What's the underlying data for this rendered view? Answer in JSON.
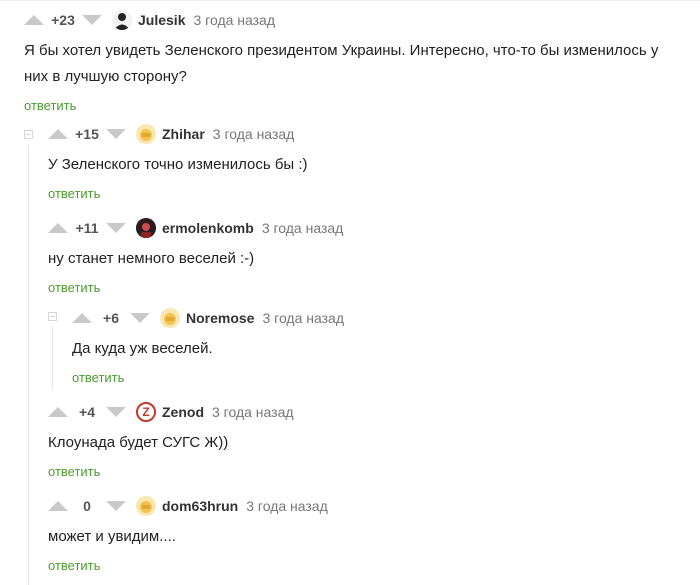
{
  "comments": [
    {
      "score": "+23",
      "author": "Julesik",
      "time": "3 года назад",
      "text": "Я бы хотел увидеть Зеленского президентом Украины. Интересно, что-то бы изменилось у них в лучшую сторону?",
      "reply": "ответить"
    },
    {
      "score": "+15",
      "author": "Zhihar",
      "time": "3 года назад",
      "text": "У Зеленского точно изменилось бы :)",
      "reply": "ответить"
    },
    {
      "score": "+11",
      "author": "ermolenkomb",
      "time": "3 года назад",
      "text": "ну станет немного веселей :-)",
      "reply": "ответить"
    },
    {
      "score": "+6",
      "author": "Noremose",
      "time": "3 года назад",
      "text": "Да куда уж веселей.",
      "reply": "ответить"
    },
    {
      "score": "+4",
      "author": "Zenod",
      "time": "3 года назад",
      "text": "Клоунада будет СУГС Ж))",
      "reply": "ответить"
    },
    {
      "score": "0",
      "author": "dom63hrun",
      "time": "3 года назад",
      "text": "может и увидим....",
      "reply": "ответить"
    }
  ],
  "avatar_letters": {
    "zenod": "Z"
  }
}
